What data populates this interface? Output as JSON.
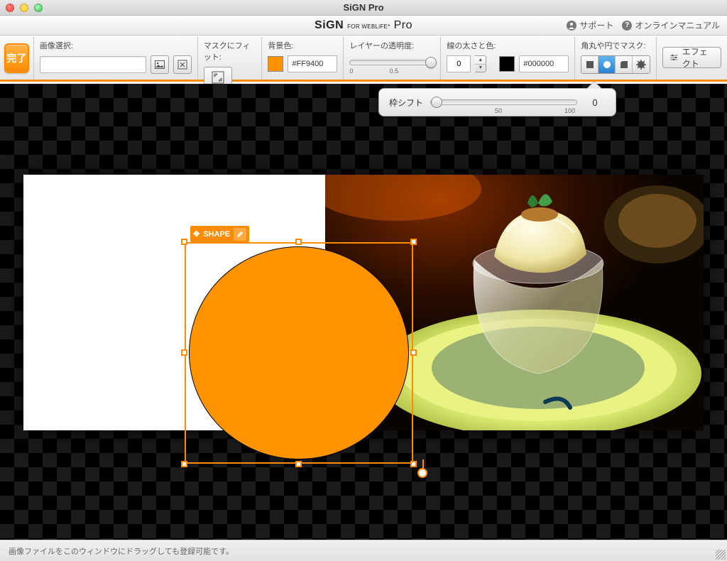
{
  "window_title": "SiGN Pro",
  "brand": {
    "name": "SiGN",
    "tag": "FOR WEBLiFE*",
    "suffix": "Pro"
  },
  "header_links": {
    "support": "サポート",
    "manual": "オンラインマニュアル"
  },
  "toolbar": {
    "done": "完了",
    "image_select_label": "画像選択:",
    "fit_mask_label": "マスクにフィット:",
    "bg_color_label": "背景色:",
    "bg_color_hex": "#FF9400",
    "opacity_label": "レイヤーの透明度:",
    "opacity_min": "0",
    "opacity_mid": "0.5",
    "border_label": "線の太さと色:",
    "border_width": "0",
    "border_hex": "#000000",
    "mask_label": "角丸や円でマスク:",
    "effect_label": "エフェクト"
  },
  "popover": {
    "label": "枠シフト",
    "tick_mid": "50",
    "tick_max": "100",
    "value": "0"
  },
  "shape_tag": {
    "label": "SHAPE"
  },
  "footer": {
    "hint": "画像ファイルをこのウィンドウにドラッグしても登録可能です。"
  },
  "colors": {
    "accent": "#ff8c00",
    "shape_fill": "#ff9400"
  }
}
